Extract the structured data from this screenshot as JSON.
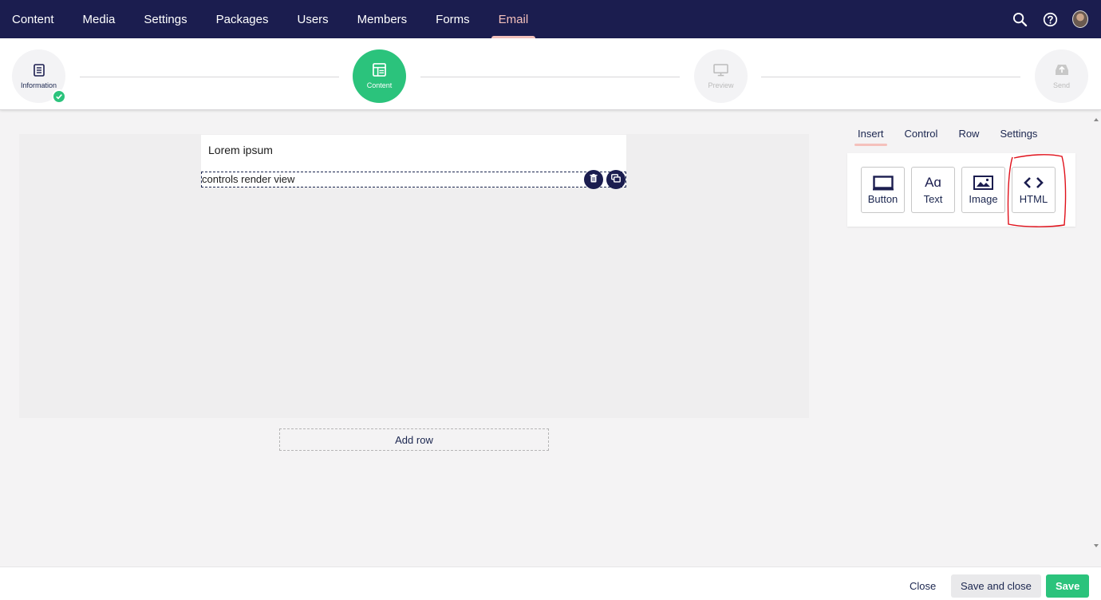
{
  "nav": {
    "items": [
      {
        "label": "Content"
      },
      {
        "label": "Media"
      },
      {
        "label": "Settings"
      },
      {
        "label": "Packages"
      },
      {
        "label": "Users"
      },
      {
        "label": "Members"
      },
      {
        "label": "Forms"
      },
      {
        "label": "Email",
        "active": true
      }
    ],
    "icons": [
      "search-icon",
      "help-icon",
      "user-avatar"
    ]
  },
  "steps": [
    {
      "label": "Information",
      "state": "completed",
      "icon": "document-icon"
    },
    {
      "label": "Content",
      "state": "current",
      "icon": "layout-icon"
    },
    {
      "label": "Preview",
      "state": "disabled",
      "icon": "monitor-icon"
    },
    {
      "label": "Send",
      "state": "disabled",
      "icon": "send-icon"
    }
  ],
  "editor": {
    "heading": "Lorem ipsum",
    "control_text": "controls render view",
    "add_row_label": "Add row",
    "control_actions": [
      "trash-icon",
      "copy-icon"
    ]
  },
  "panel": {
    "tabs": [
      {
        "label": "Insert",
        "active": true
      },
      {
        "label": "Control"
      },
      {
        "label": "Row"
      },
      {
        "label": "Settings"
      }
    ],
    "tools": [
      {
        "label": "Button",
        "icon": "button-icon"
      },
      {
        "label": "Text",
        "icon": "text-icon",
        "glyph": "Aɑ"
      },
      {
        "label": "Image",
        "icon": "image-icon"
      },
      {
        "label": "HTML",
        "icon": "code-icon"
      }
    ]
  },
  "footer": {
    "close_label": "Close",
    "save_close_label": "Save and close",
    "save_label": "Save"
  },
  "colors": {
    "nav_bg": "#1b1d4f",
    "accent_active": "#f5c1bc",
    "success": "#2bc37c",
    "annotation": "#e0101a"
  }
}
